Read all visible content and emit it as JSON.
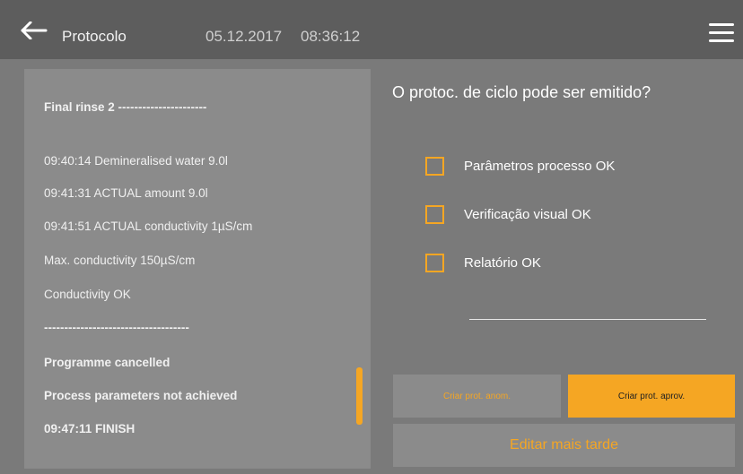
{
  "header": {
    "title": "Protocolo",
    "date": "05.12.2017",
    "time": "08:36:12",
    "back_icon": "arrow-left-icon",
    "menu_icon": "hamburger-menu-icon"
  },
  "log": {
    "lines": [
      "Final rinse 2 ----------------------",
      "09:40:14 Demineralised water 9.0l",
      "09:41:31 ACTUAL amount 9.0l",
      "09:41:51 ACTUAL conductivity 1µS/cm",
      "Max. conductivity 150µS/cm",
      "Conductivity OK",
      "------------------------------------",
      "Programme cancelled",
      "Process parameters not achieved",
      "09:47:11 FINISH"
    ]
  },
  "release": {
    "question": "O protoc. de ciclo pode ser emitido?",
    "checks": [
      {
        "label": "Parâmetros processo OK",
        "checked": false
      },
      {
        "label": "Verificação visual OK",
        "checked": false
      },
      {
        "label": "Relatório OK",
        "checked": false
      }
    ]
  },
  "buttons": {
    "anom": "Criar prot. anom.",
    "aprov": "Criar prot. aprov.",
    "later": "Editar mais tarde"
  },
  "colors": {
    "accent": "#f5a623",
    "topbar": "#5d5d5d",
    "background": "#7a7a7a",
    "panel": "#8b8b8b"
  }
}
